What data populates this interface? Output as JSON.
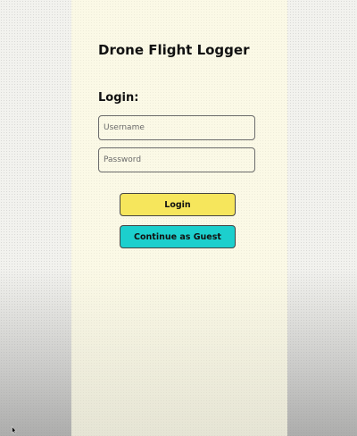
{
  "app": {
    "title": "Drone Flight Logger"
  },
  "login": {
    "heading": "Login:",
    "username": {
      "value": "",
      "placeholder": "Username"
    },
    "password": {
      "value": "",
      "placeholder": "Password"
    },
    "login_button_label": "Login",
    "guest_button_label": "Continue as Guest"
  },
  "colors": {
    "panel_background": "#fbf9e6",
    "login_button": "#f6e65c",
    "guest_button": "#1ccfcd",
    "input_border": "#6b6b6b"
  },
  "icons": {
    "cursor": "mouse-pointer-icon"
  }
}
